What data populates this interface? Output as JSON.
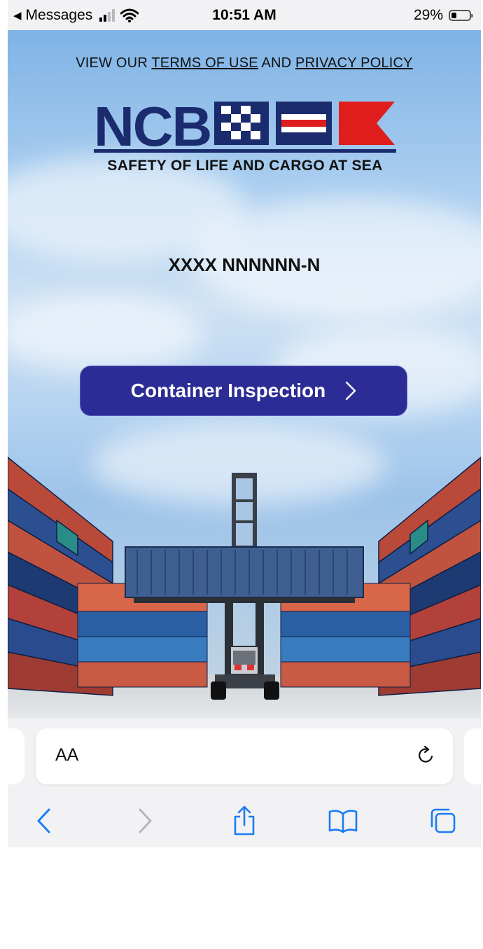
{
  "status_bar": {
    "back_app": "Messages",
    "time": "10:51 AM",
    "battery_percent": "29%",
    "battery_level": 0.29,
    "icons": [
      "back-arrow-icon",
      "cellular-signal-icon",
      "wifi-icon",
      "battery-icon"
    ]
  },
  "page": {
    "legal_prefix": "VIEW OUR",
    "terms_link": "TERMS OF USE",
    "legal_and": "AND",
    "privacy_link": "PRIVACY POLICY",
    "logo_text": "NCB",
    "logo_tagline": "SAFETY OF LIFE AND CARGO AT SEA",
    "container_id": "XXXX NNNNNN-N",
    "cta_label": "Container Inspection",
    "colors": {
      "logo_navy": "#1a2b6e",
      "logo_red": "#e01d1d",
      "cta_background": "#2b2c95",
      "link_blue": "#1a7cf5"
    }
  },
  "browser": {
    "reader_button": "AA",
    "icons": [
      "text-size-icon",
      "reload-icon",
      "back-icon",
      "forward-icon",
      "share-icon",
      "bookmarks-icon",
      "tabs-icon"
    ]
  }
}
